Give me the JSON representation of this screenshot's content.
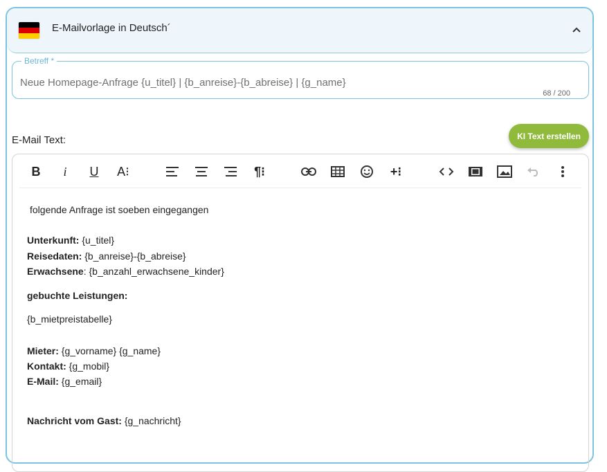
{
  "panel": {
    "title": "E-Mailvorlage in Deutsch´",
    "flag_colors": [
      "#000000",
      "#DD0000",
      "#FFCE00"
    ],
    "collapse_icon": "chevron-up-icon"
  },
  "subject": {
    "label": "Betreff *",
    "value": "Neue Homepage-Anfrage {u_titel} | {b_anreise}-{b_abreise} | {g_name}",
    "counter": "68 / 200"
  },
  "email_text_label": "E-Mail Text:",
  "ki_button": {
    "label": "KI Text erstellen",
    "color": "#8fba3c"
  },
  "toolbar": {
    "bold": "B",
    "italic": "i",
    "underline": "U",
    "font_size": "A⁝",
    "paragraph": "¶⁝",
    "insert_more": "+⁝",
    "icons": [
      "bold-icon",
      "italic-icon",
      "underline-icon",
      "font-size-icon",
      "align-left-icon",
      "align-center-icon",
      "align-right-icon",
      "paragraph-format-icon",
      "link-icon",
      "table-icon",
      "emoji-icon",
      "insert-more-icon",
      "code-view-icon",
      "video-icon",
      "image-icon",
      "undo-icon",
      "more-options-icon"
    ]
  },
  "content": {
    "intro": "folgende Anfrage ist soeben eingegangen",
    "unterkunft_label": "Unterkunft:",
    "unterkunft_value": " {u_titel}",
    "reisedaten_label": "Reisedaten:",
    "reisedaten_value": " {b_anreise}-{b_abreise}",
    "erwachsene_label": "Erwachsene",
    "erwachsene_value": ": {b_anzahl_erwachsene_kinder}",
    "leistungen_label": "gebuchte Leistungen:",
    "mietpreistabelle": "{b_mietpreistabelle}",
    "mieter_label": "Mieter:",
    "mieter_value": " {g_vorname} {g_name}",
    "kontakt_label": "Kontakt:",
    "kontakt_value": " {g_mobil}",
    "email_label": "E-Mail:",
    "email_value": " {g_email}",
    "nachricht_label": "Nachricht vom Gast:",
    "nachricht_value": " {g_nachricht}"
  }
}
